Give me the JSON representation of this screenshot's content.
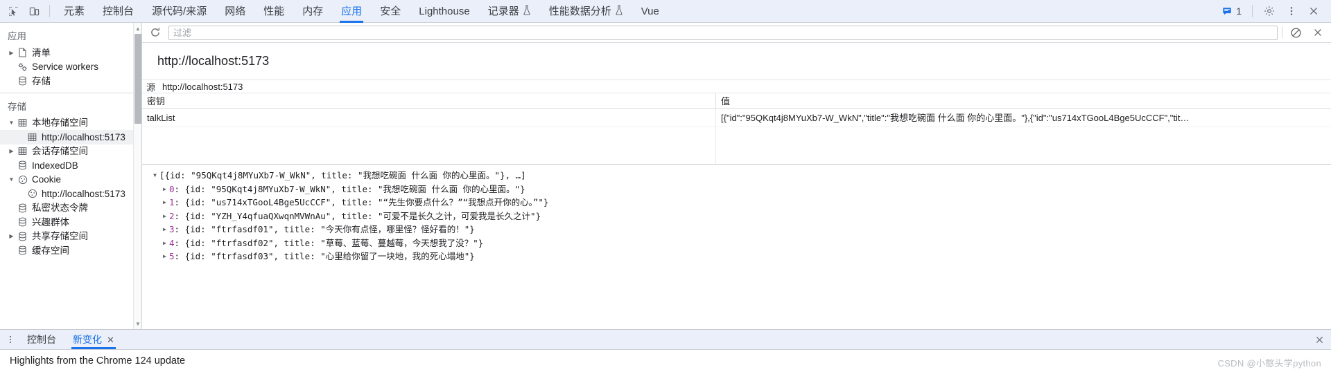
{
  "toolbar": {
    "inspect_icon": "inspect-cursor-icon",
    "device_icon": "device-toolbar-icon",
    "tabs": [
      {
        "label": "元素",
        "name": "tab-elements",
        "active": false,
        "flask": false
      },
      {
        "label": "控制台",
        "name": "tab-console",
        "active": false,
        "flask": false
      },
      {
        "label": "源代码/来源",
        "name": "tab-sources",
        "active": false,
        "flask": false
      },
      {
        "label": "网络",
        "name": "tab-network",
        "active": false,
        "flask": false
      },
      {
        "label": "性能",
        "name": "tab-performance",
        "active": false,
        "flask": false
      },
      {
        "label": "内存",
        "name": "tab-memory",
        "active": false,
        "flask": false
      },
      {
        "label": "应用",
        "name": "tab-application",
        "active": true,
        "flask": false
      },
      {
        "label": "安全",
        "name": "tab-security",
        "active": false,
        "flask": false
      },
      {
        "label": "Lighthouse",
        "name": "tab-lighthouse",
        "active": false,
        "flask": false
      },
      {
        "label": "记录器",
        "name": "tab-recorder",
        "active": false,
        "flask": true
      },
      {
        "label": "性能数据分析",
        "name": "tab-performance-insights",
        "active": false,
        "flask": true
      },
      {
        "label": "Vue",
        "name": "tab-vue",
        "active": false,
        "flask": false
      }
    ],
    "message_count": "1",
    "message_icon": "message-bubble-icon",
    "settings_icon": "gear-icon",
    "more_icon": "more-vertical-icon",
    "close_icon": "close-icon"
  },
  "sidebar": {
    "application": {
      "title": "应用",
      "items": [
        {
          "label": "清单",
          "icon": "manifest-document-icon",
          "twisty": "collapsed",
          "indent": 1,
          "selected": false
        },
        {
          "label": "Service workers",
          "icon": "service-worker-gears-icon",
          "twisty": "none",
          "indent": 1,
          "selected": false
        },
        {
          "label": "存储",
          "icon": "database-icon",
          "twisty": "none",
          "indent": 1,
          "selected": false
        }
      ]
    },
    "storage": {
      "title": "存储",
      "items": [
        {
          "label": "本地存储空间",
          "icon": "table-icon",
          "twisty": "expanded",
          "indent": 1,
          "selected": false
        },
        {
          "label": "http://localhost:5173",
          "icon": "table-icon",
          "twisty": "none",
          "indent": 2,
          "selected": true
        },
        {
          "label": "会话存储空间",
          "icon": "table-icon",
          "twisty": "collapsed",
          "indent": 1,
          "selected": false
        },
        {
          "label": "IndexedDB",
          "icon": "database-icon",
          "twisty": "none",
          "indent": 1,
          "selected": false
        },
        {
          "label": "Cookie",
          "icon": "cookie-icon",
          "twisty": "expanded",
          "indent": 1,
          "selected": false
        },
        {
          "label": "http://localhost:5173",
          "icon": "cookie-icon",
          "twisty": "none",
          "indent": 2,
          "selected": false
        },
        {
          "label": "私密状态令牌",
          "icon": "database-icon",
          "twisty": "none",
          "indent": 1,
          "selected": false
        },
        {
          "label": "兴趣群体",
          "icon": "database-icon",
          "twisty": "none",
          "indent": 1,
          "selected": false
        },
        {
          "label": "共享存储空间",
          "icon": "database-icon",
          "twisty": "collapsed",
          "indent": 1,
          "selected": false
        },
        {
          "label": "缓存空间",
          "icon": "database-icon",
          "twisty": "none",
          "indent": 1,
          "selected": false
        }
      ]
    }
  },
  "main": {
    "filter_bar": {
      "refresh_icon": "refresh-icon",
      "filter_placeholder": "过滤",
      "filter_value": "",
      "clear_all_icon": "clear-all-icon",
      "delete_selected_icon": "close-icon"
    },
    "origin_title": "http://localhost:5173",
    "meta": {
      "label": "源",
      "value": "http://localhost:5173"
    },
    "grid": {
      "columns": [
        "密钥",
        "值"
      ],
      "rows": [
        {
          "key": "talkList",
          "value": "[{\"id\":\"95QKqt4j8MYuXb7-W_WkN\",\"title\":\"我想吃碗面 什么面 你的心里面。\"},{\"id\":\"us714xTGooL4Bge5UcCCF\",\"tit…"
        }
      ]
    },
    "preview": {
      "root": {
        "arrow": "expanded",
        "text": "[{id: \"95QKqt4j8MYuXb7-W_WkN\", title: \"我想吃碗面 什么面 你的心里面。\"}, …]"
      },
      "children": [
        {
          "index": "0",
          "text": ": {id: \"95QKqt4j8MYuXb7-W_WkN\", title: \"我想吃碗面 什么面 你的心里面。\"}"
        },
        {
          "index": "1",
          "text": ": {id: \"us714xTGooL4Bge5UcCCF\", title: \"“先生你要点什么？”“我想点开你的心。”\"}"
        },
        {
          "index": "2",
          "text": ": {id: \"YZH_Y4qfuaQXwqnMVWnAu\", title: \"可爱不是长久之计，可爱我是长久之计\"}"
        },
        {
          "index": "3",
          "text": ": {id: \"ftrfasdf01\", title: \"今天你有点怪，哪里怪？怪好看的！\"}"
        },
        {
          "index": "4",
          "text": ": {id: \"ftrfasdf02\", title: \"草莓、蓝莓、蔓越莓，今天想我了没？\"}"
        },
        {
          "index": "5",
          "text": ": {id: \"ftrfasdf03\", title: \"心里给你留了一块地，我的死心塌地\"}"
        }
      ]
    }
  },
  "drawer": {
    "more_icon": "more-vertical-icon",
    "tabs": [
      {
        "label": "控制台",
        "name": "drawer-tab-console",
        "active": false,
        "closable": false
      },
      {
        "label": "新变化",
        "name": "drawer-tab-whats-new",
        "active": true,
        "closable": true
      }
    ],
    "close_label": "✕",
    "content_text": "Highlights from the Chrome 124 update",
    "watermark": "CSDN @小憨头学python"
  },
  "colors": {
    "accent": "#1a73e8",
    "toolbar_bg": "#ebeffa",
    "index_purple": "#a0309a"
  }
}
